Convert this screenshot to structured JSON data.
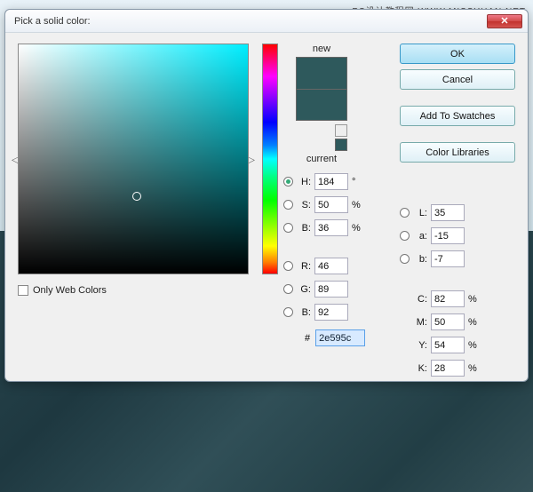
{
  "watermark": "PS设计教程网 WWW.MISSYUAN.NET",
  "dialog": {
    "title": "Pick a solid color:",
    "close": "✕"
  },
  "preview": {
    "new_label": "new",
    "current_label": "current"
  },
  "fields": {
    "H": {
      "label": "H:",
      "value": "184",
      "unit": "°"
    },
    "S": {
      "label": "S:",
      "value": "50",
      "unit": "%"
    },
    "Bb": {
      "label": "B:",
      "value": "36",
      "unit": "%"
    },
    "R": {
      "label": "R:",
      "value": "46",
      "unit": ""
    },
    "G": {
      "label": "G:",
      "value": "89",
      "unit": ""
    },
    "B2": {
      "label": "B:",
      "value": "92",
      "unit": ""
    },
    "L": {
      "label": "L:",
      "value": "35",
      "unit": ""
    },
    "a": {
      "label": "a:",
      "value": "-15",
      "unit": ""
    },
    "b": {
      "label": "b:",
      "value": "-7",
      "unit": ""
    },
    "C": {
      "label": "C:",
      "value": "82",
      "unit": "%"
    },
    "M": {
      "label": "M:",
      "value": "50",
      "unit": "%"
    },
    "Y": {
      "label": "Y:",
      "value": "54",
      "unit": "%"
    },
    "K": {
      "label": "K:",
      "value": "28",
      "unit": "%"
    }
  },
  "hex": {
    "label": "#",
    "value": "2e595c"
  },
  "web_only": "Only Web Colors",
  "buttons": {
    "ok": "OK",
    "cancel": "Cancel",
    "swatches": "Add To Swatches",
    "libraries": "Color Libraries"
  },
  "colors": {
    "selected": "#2e595c"
  }
}
